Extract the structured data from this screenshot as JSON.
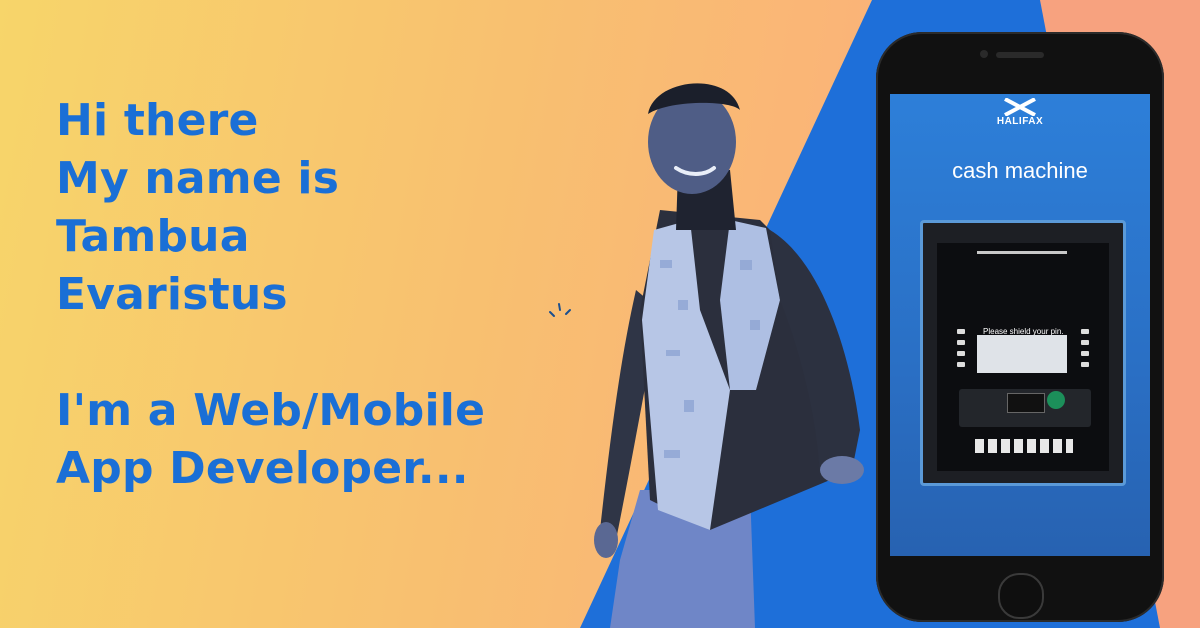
{
  "intro": {
    "lines": [
      "Hi there",
      "My name is",
      "Tambua",
      "Evaristus"
    ],
    "role_lines": [
      "I'm a Web/Mobile",
      "App Developer..."
    ]
  },
  "phone": {
    "brand": "HALIFAX",
    "caption": "cash machine",
    "atm_message": "Please shield your pin."
  },
  "colors": {
    "headline": "#1a6fd6",
    "accent_blue": "#1e6fd9",
    "bg_warm_left": "#f7d56a",
    "bg_warm_right": "#f7a27f"
  }
}
